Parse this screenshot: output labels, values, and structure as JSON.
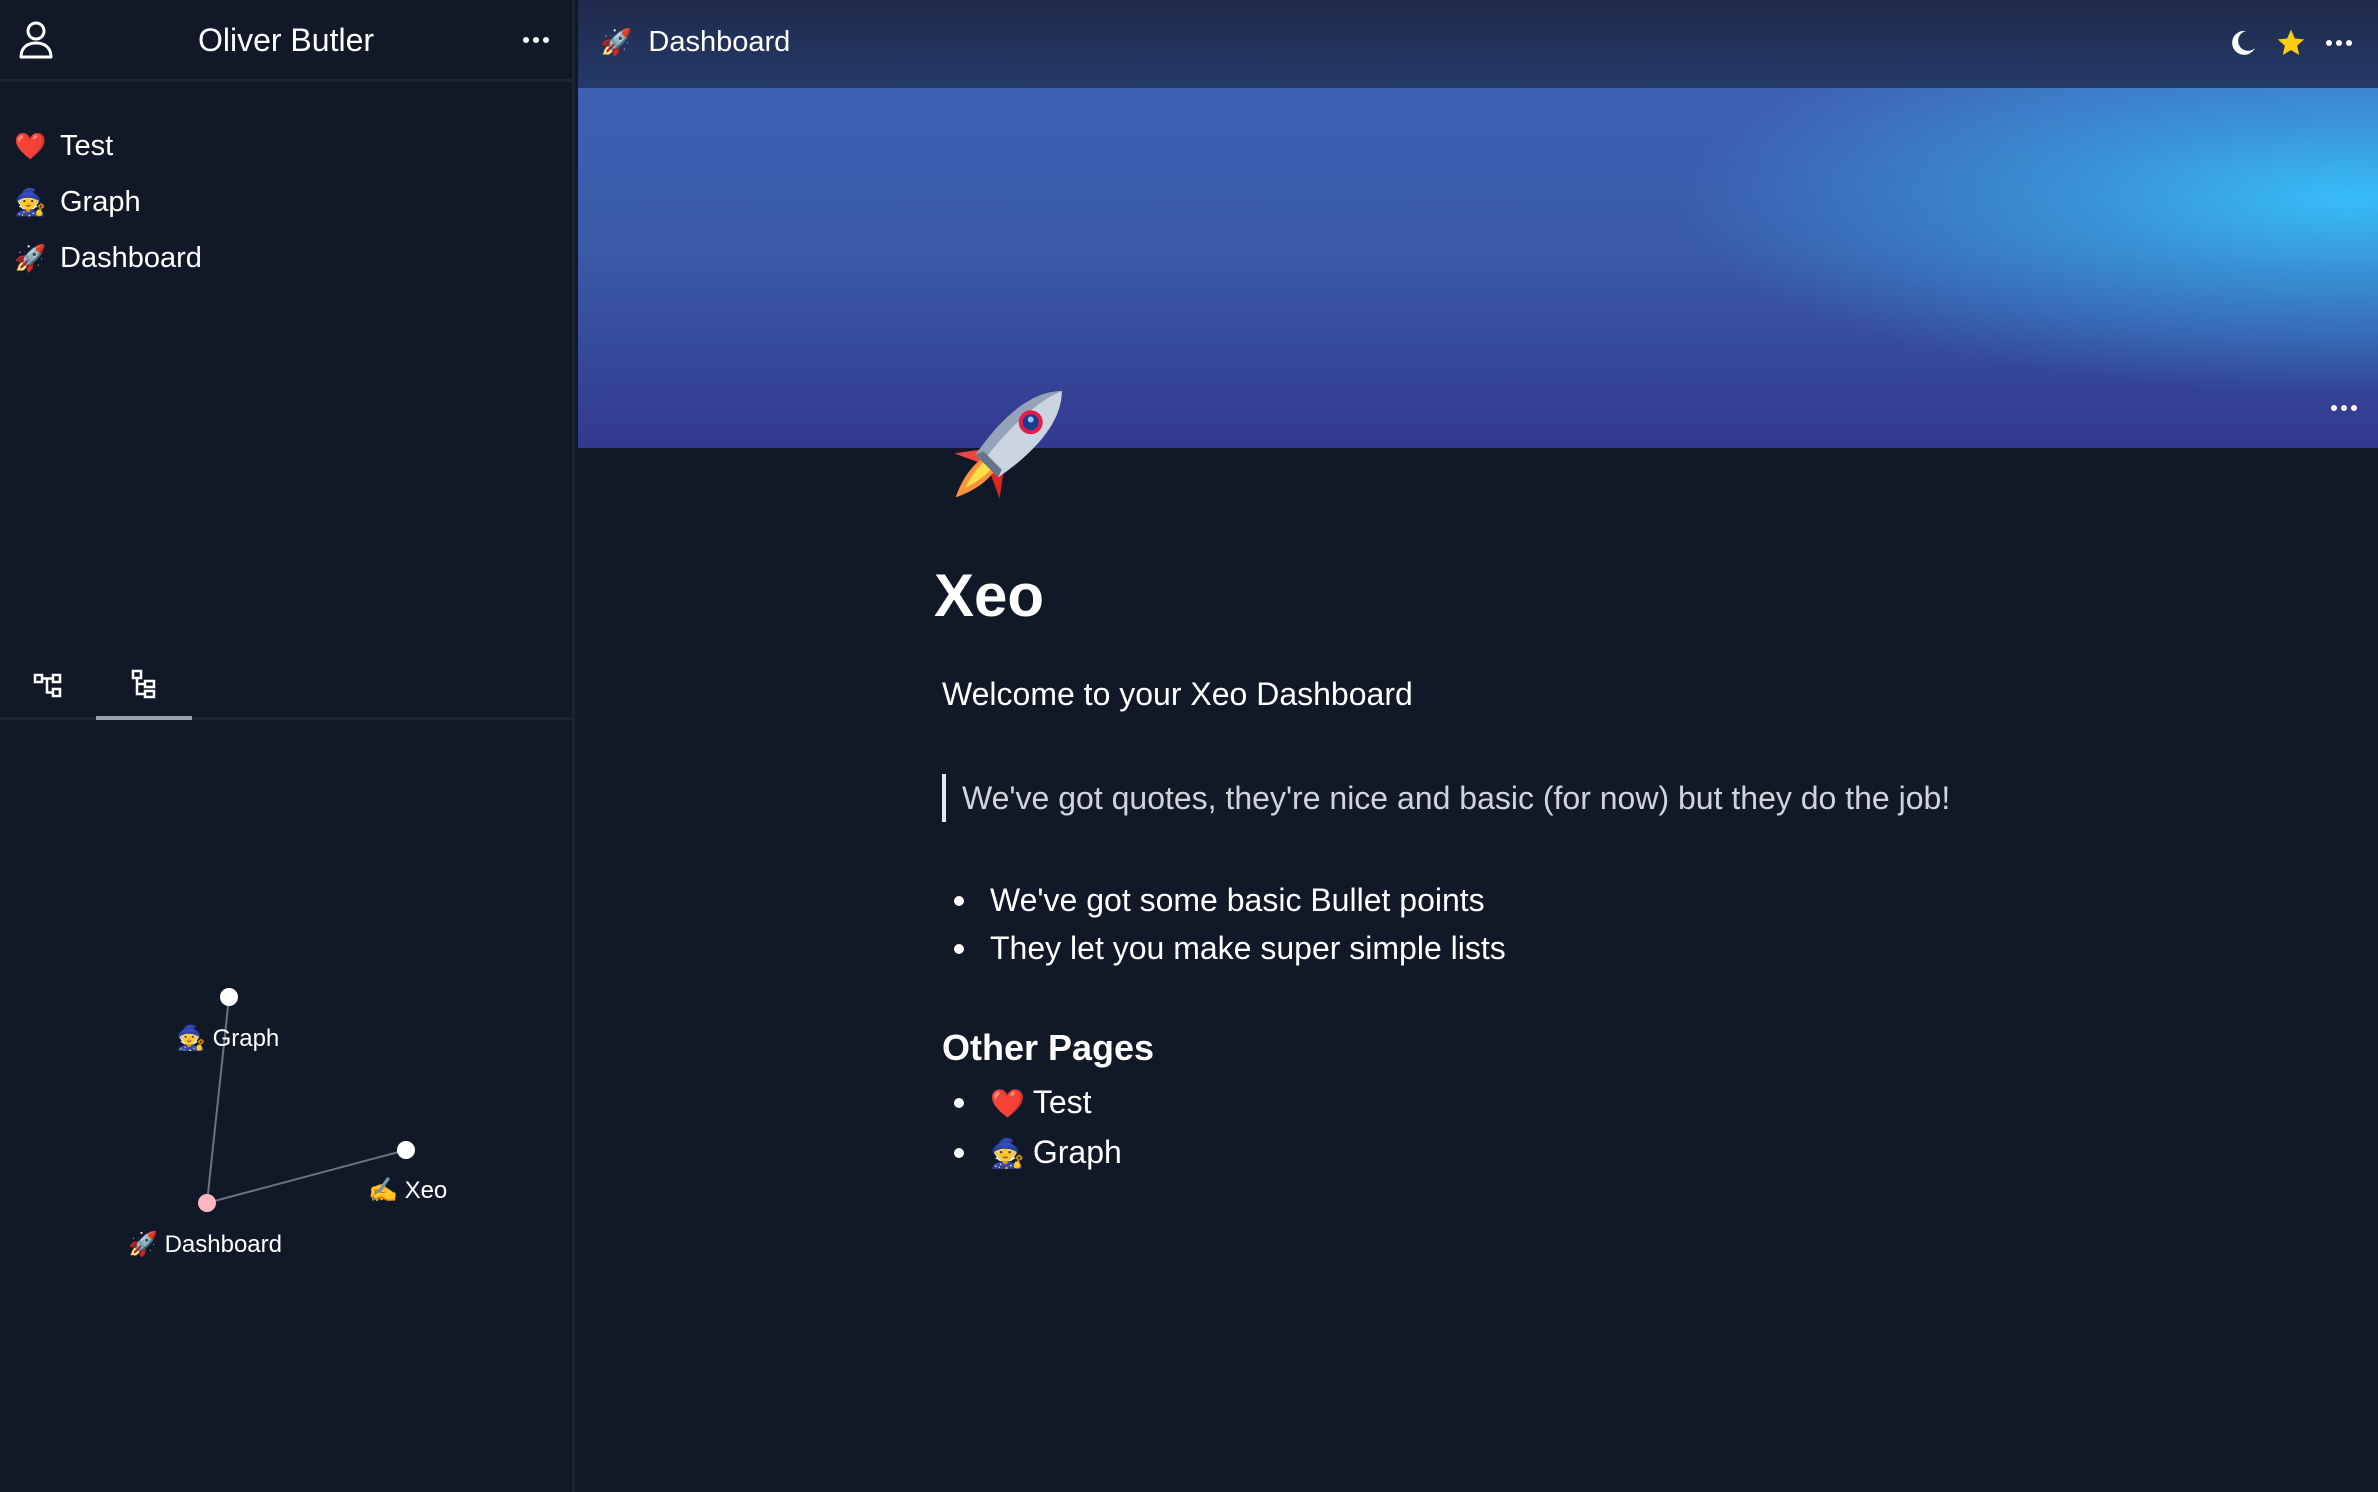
{
  "sidebar": {
    "user_name": "Oliver Butler",
    "items": [
      {
        "emoji": "❤️",
        "label": "Test"
      },
      {
        "emoji": "🧙",
        "label": "Graph"
      },
      {
        "emoji": "🚀",
        "label": "Dashboard"
      }
    ],
    "view_tabs": [
      "graph-view-icon",
      "tree-view-icon"
    ],
    "active_view_tab": "tree-view-icon"
  },
  "graph": {
    "nodes": [
      {
        "id": "graph",
        "emoji": "🧙",
        "label": "Graph",
        "color": "#ffffff"
      },
      {
        "id": "dashboard",
        "emoji": "🚀",
        "label": "Dashboard",
        "color": "#fbb6c0"
      },
      {
        "id": "xeo",
        "emoji": "✍️",
        "label": "Xeo",
        "color": "#ffffff"
      }
    ],
    "edges": [
      [
        "graph",
        "dashboard"
      ],
      [
        "dashboard",
        "xeo"
      ]
    ]
  },
  "topbar": {
    "emoji": "🚀",
    "title": "Dashboard",
    "actions": [
      "moon-icon",
      "star-icon",
      "more-icon"
    ],
    "star_color": "#facc15"
  },
  "page": {
    "title": "Xeo",
    "welcome": "Welcome to your Xeo Dashboard",
    "quote": "We've got quotes, they're nice and basic (for now) but they do the job!",
    "bullets": [
      "We've got some basic Bullet points",
      "They let you make super simple lists"
    ],
    "other_heading": "Other Pages",
    "other_pages": [
      {
        "emoji": "❤️",
        "label": "Test"
      },
      {
        "emoji": "🧙",
        "label": "Graph"
      }
    ]
  },
  "colors": {
    "background": "#111827",
    "cover_top": "#3f5fb3",
    "cover_bottom": "#32398e",
    "cover_glow": "#38bdf8"
  }
}
